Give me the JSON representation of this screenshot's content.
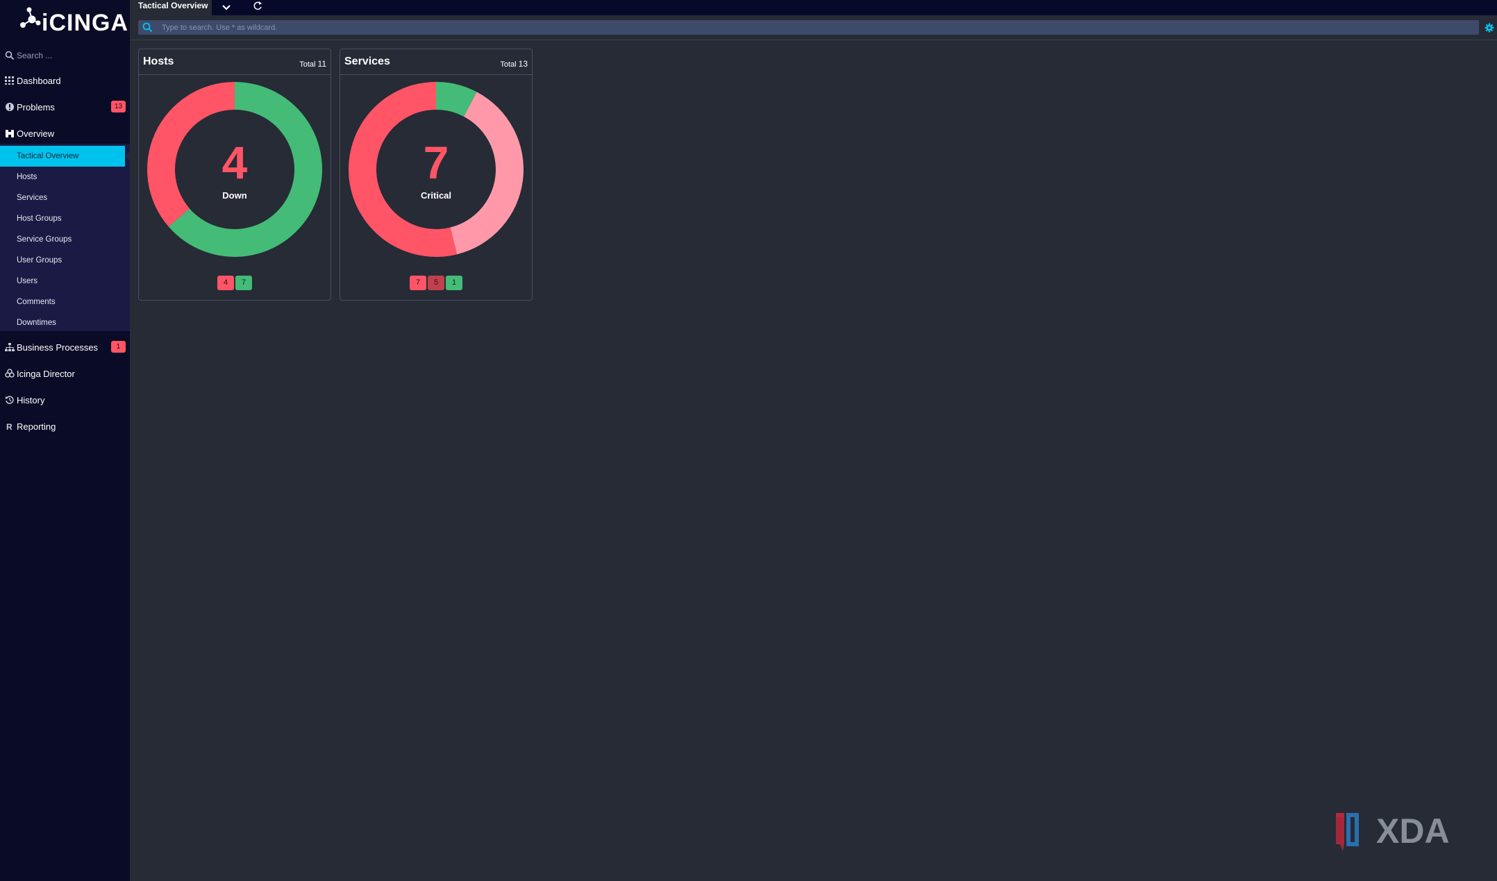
{
  "app": {
    "logo_text": "iCINGA"
  },
  "topbar": {
    "tab_title": "Tactical Overview"
  },
  "search": {
    "sidebar_placeholder": "Search ...",
    "main_placeholder": "Type to search. Use * as wildcard."
  },
  "sidebar": {
    "items": [
      {
        "label": "Dashboard",
        "icon": "dashboard-icon"
      },
      {
        "label": "Problems",
        "icon": "problems-icon",
        "badge": "13"
      },
      {
        "label": "Overview",
        "icon": "binoculars-icon"
      },
      {
        "label": "Business Processes",
        "icon": "sitemap-icon",
        "badge": "1"
      },
      {
        "label": "Icinga Director",
        "icon": "director-icon"
      },
      {
        "label": "History",
        "icon": "history-icon"
      },
      {
        "label": "Reporting",
        "icon": "reporting-icon"
      }
    ],
    "overview_sub": [
      "Tactical Overview",
      "Hosts",
      "Services",
      "Host Groups",
      "Service Groups",
      "User Groups",
      "Users",
      "Comments",
      "Downtimes"
    ]
  },
  "cards": {
    "hosts": {
      "title": "Hosts",
      "total_label": "Total",
      "total": "11",
      "center_value": "4",
      "center_label": "Down",
      "badges": [
        "4",
        "7"
      ],
      "segments": [
        {
          "state": "down",
          "value": 4,
          "color": "#ff5566"
        },
        {
          "state": "up",
          "value": 7,
          "color": "#44bb77"
        }
      ]
    },
    "services": {
      "title": "Services",
      "total_label": "Total",
      "total": "13",
      "center_value": "7",
      "center_label": "Critical",
      "badges": [
        "7",
        "5",
        "1"
      ],
      "segments": [
        {
          "state": "critical",
          "value": 7,
          "color": "#ff5566"
        },
        {
          "state": "critical-handled",
          "value": 5,
          "color": "#ff99aa"
        },
        {
          "state": "ok",
          "value": 1,
          "color": "#44bb77"
        }
      ]
    }
  },
  "watermark": {
    "text": "XDA"
  }
}
